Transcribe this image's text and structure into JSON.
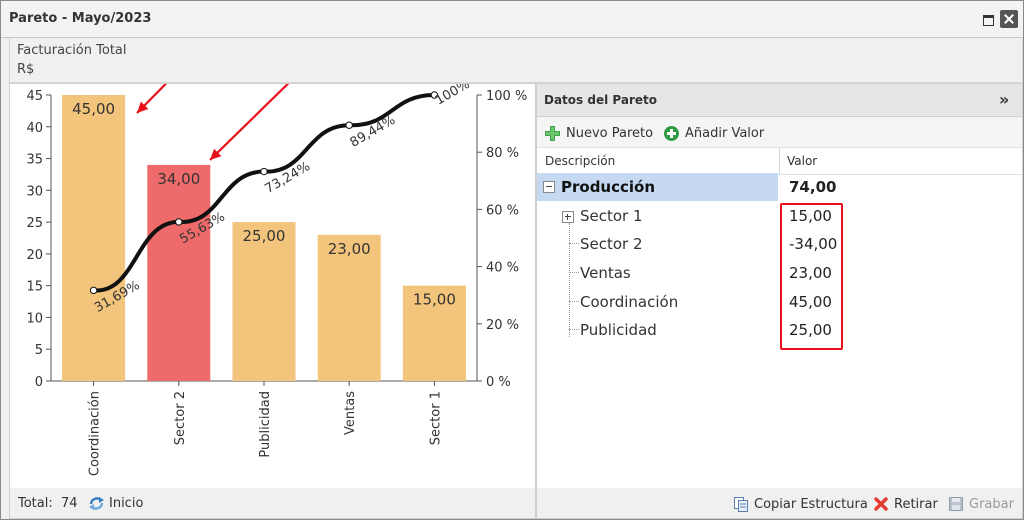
{
  "window": {
    "title": "Pareto - Mayo/2023",
    "subtitle_line1": "Facturación Total",
    "subtitle_line2": "R$"
  },
  "chart_data": {
    "type": "bar",
    "categories": [
      "Coordinación",
      "Sector 2",
      "Publicidad",
      "Ventas",
      "Sector 1"
    ],
    "values": [
      45,
      34,
      25,
      23,
      15
    ],
    "value_labels": [
      "45,00",
      "34,00",
      "25,00",
      "23,00",
      "15,00"
    ],
    "bar_colors": [
      "#f3c47b",
      "#ef6a6a",
      "#f3c47b",
      "#f3c47b",
      "#f3c47b"
    ],
    "ylim": [
      0,
      45
    ],
    "y_ticks": [
      0,
      5,
      10,
      15,
      20,
      25,
      30,
      35,
      40,
      45
    ],
    "y2_ticks": [
      "0 %",
      "20 %",
      "40 %",
      "60 %",
      "80 %",
      "100 %"
    ],
    "cumulative_percent": [
      31.69,
      55.63,
      73.24,
      89.44,
      100
    ],
    "cumulative_labels": [
      "31,69%",
      "55,63%",
      "73,24%",
      "89,44%",
      "100%"
    ],
    "grid": false,
    "line_color": "#111111",
    "arrow_color": "#e8101a"
  },
  "footer_left": {
    "total_label": "Total:",
    "total_value": "74",
    "inicio_label": "Inicio"
  },
  "right_panel": {
    "title": "Datos del Pareto",
    "toolbar": {
      "new_pareto": "Nuevo Pareto",
      "add_value": "Añadir Valor"
    },
    "columns": {
      "description": "Descripción",
      "value": "Valor"
    },
    "root": {
      "label": "Producción",
      "value": "74,00"
    },
    "children": [
      {
        "label": "Sector 1",
        "value": "15,00"
      },
      {
        "label": "Sector 2",
        "value": "-34,00"
      },
      {
        "label": "Ventas",
        "value": "23,00"
      },
      {
        "label": "Coordinación",
        "value": "45,00"
      },
      {
        "label": "Publicidad",
        "value": "25,00"
      }
    ],
    "footer": {
      "copy": "Copiar Estructura",
      "remove": "Retirar",
      "save": "Grabar"
    }
  }
}
